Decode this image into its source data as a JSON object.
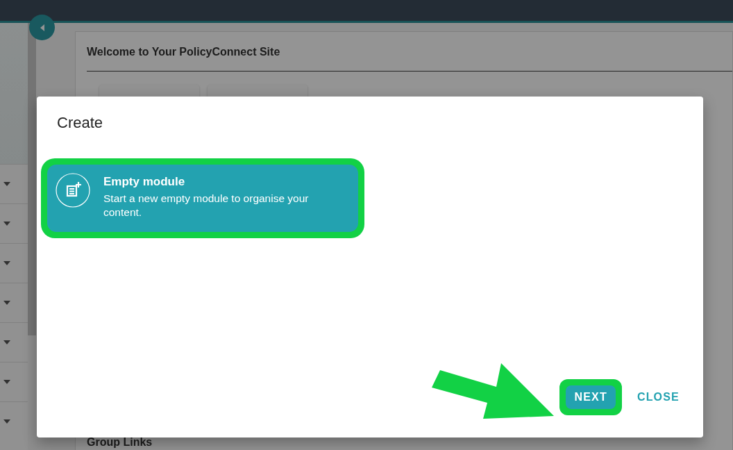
{
  "page": {
    "title": "Welcome to Your PolicyConnect Site",
    "section_title": "Group Links"
  },
  "dialog": {
    "title": "Create",
    "options": [
      {
        "title": "Empty module",
        "description": "Start a new empty module to organise your content.",
        "selected": true,
        "highlighted": true
      }
    ],
    "buttons": [
      {
        "label": "NEXT",
        "kind": "primary",
        "highlighted": true
      },
      {
        "label": "CLOSE",
        "kind": "text",
        "highlighted": false
      }
    ]
  }
}
